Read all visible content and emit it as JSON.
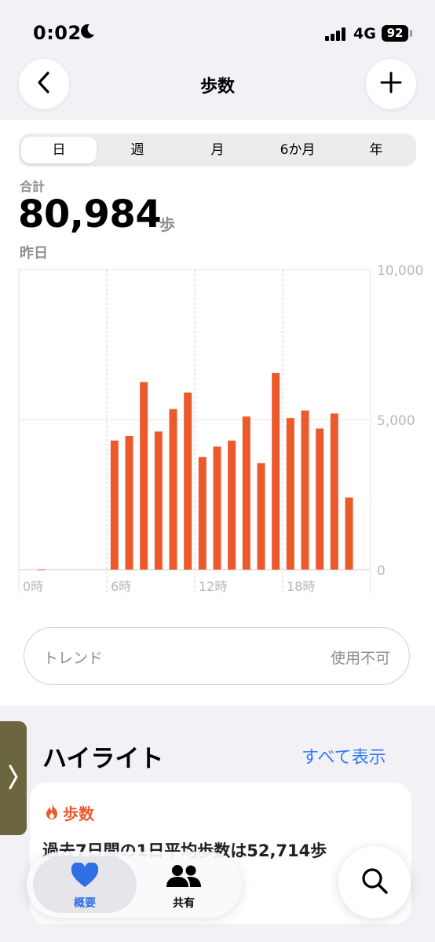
{
  "status_bar": {
    "time": "0:02",
    "network": "4G",
    "battery": "92"
  },
  "header": {
    "title": "歩数"
  },
  "segments": [
    "日",
    "週",
    "月",
    "6か月",
    "年"
  ],
  "summary": {
    "label": "合計",
    "value": "80,984",
    "unit": "歩",
    "date": "昨日"
  },
  "chart_data": {
    "type": "bar",
    "x_tick_labels": [
      "0時",
      "6時",
      "12時",
      "18時"
    ],
    "y_tick_labels": [
      "10,000",
      "5,000",
      "0"
    ],
    "ylim": [
      0,
      10000
    ],
    "categories": [
      "0",
      "1",
      "2",
      "3",
      "4",
      "5",
      "6",
      "7",
      "8",
      "9",
      "10",
      "11",
      "12",
      "13",
      "14",
      "15",
      "16",
      "17",
      "18",
      "19",
      "20",
      "21",
      "22",
      "23"
    ],
    "values": [
      0,
      10,
      0,
      0,
      0,
      0,
      4300,
      4450,
      6250,
      4600,
      5350,
      5900,
      3750,
      4100,
      4300,
      5100,
      3550,
      6550,
      5050,
      5300,
      4700,
      5200,
      2400,
      0
    ],
    "bar_color": "#ec5a2c",
    "grid": true
  },
  "trend": {
    "label": "トレンド",
    "value": "使用不可"
  },
  "highlights": {
    "title": "ハイライト",
    "show_all": "すべて表示",
    "card": {
      "category": "歩数",
      "text": "過去7日間の1日平均歩数は52,714歩"
    }
  },
  "tabs": [
    {
      "label": "概要",
      "icon": "heart-icon"
    },
    {
      "label": "共有",
      "icon": "people-icon"
    }
  ],
  "colors": {
    "accent": "#ec5a2c",
    "link": "#3478f6",
    "tab_active": "#2f6ee5"
  }
}
